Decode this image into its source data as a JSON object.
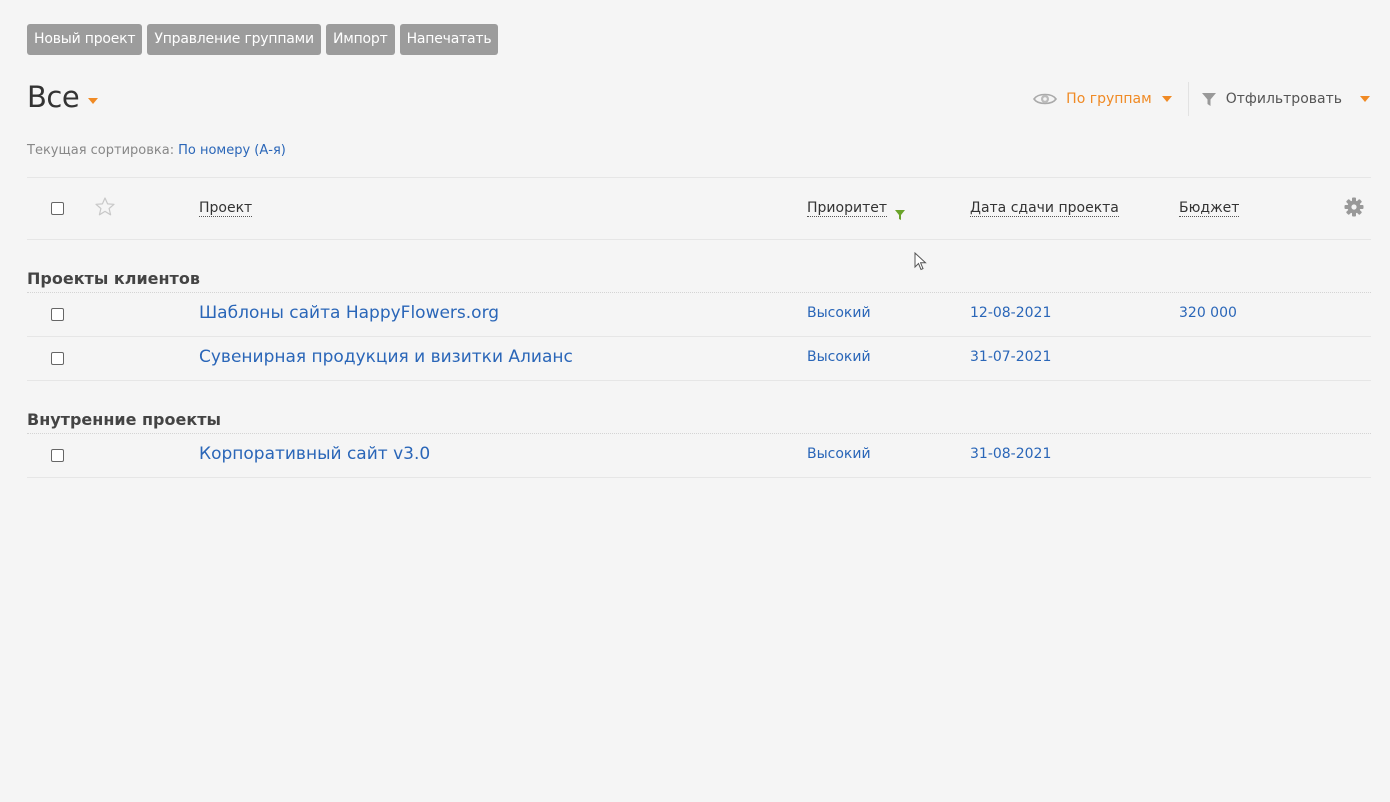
{
  "toolbar": {
    "new_project": "Новый проект",
    "manage_groups": "Управление группами",
    "import": "Импорт",
    "print": "Напечатать"
  },
  "view": {
    "title": "Все",
    "group_by_label": "По группам",
    "filter_label": "Отфильтровать"
  },
  "sort": {
    "label": "Текущая сортировка:",
    "value": "По номеру (А-я)"
  },
  "columns": {
    "project": "Проект",
    "priority": "Приоритет",
    "due_date": "Дата сдачи проекта",
    "budget": "Бюджет"
  },
  "groups": [
    {
      "title": "Проекты клиентов",
      "rows": [
        {
          "name": "Шаблоны сайта HappyFlowers.org",
          "priority": "Высокий",
          "due_date": "12-08-2021",
          "budget": "320 000"
        },
        {
          "name": "Сувенирная продукция и визитки Алианс",
          "priority": "Высокий",
          "due_date": "31-07-2021",
          "budget": ""
        }
      ]
    },
    {
      "title": "Внутренние проекты",
      "rows": [
        {
          "name": "Корпоративный сайт v3.0",
          "priority": "Высокий",
          "due_date": "31-08-2021",
          "budget": ""
        }
      ]
    }
  ],
  "colors": {
    "accent_orange": "#f08a24",
    "link_blue": "#2a66b8",
    "button_gray": "#9c9c9c",
    "filter_green": "#6aa32a"
  },
  "icons": {
    "view": "eye-icon",
    "filter": "funnel-icon",
    "favorite": "star-outline-icon",
    "settings": "gear-icon",
    "priority_filter": "funnel-green-icon",
    "cursor": "mouse-pointer-icon"
  }
}
